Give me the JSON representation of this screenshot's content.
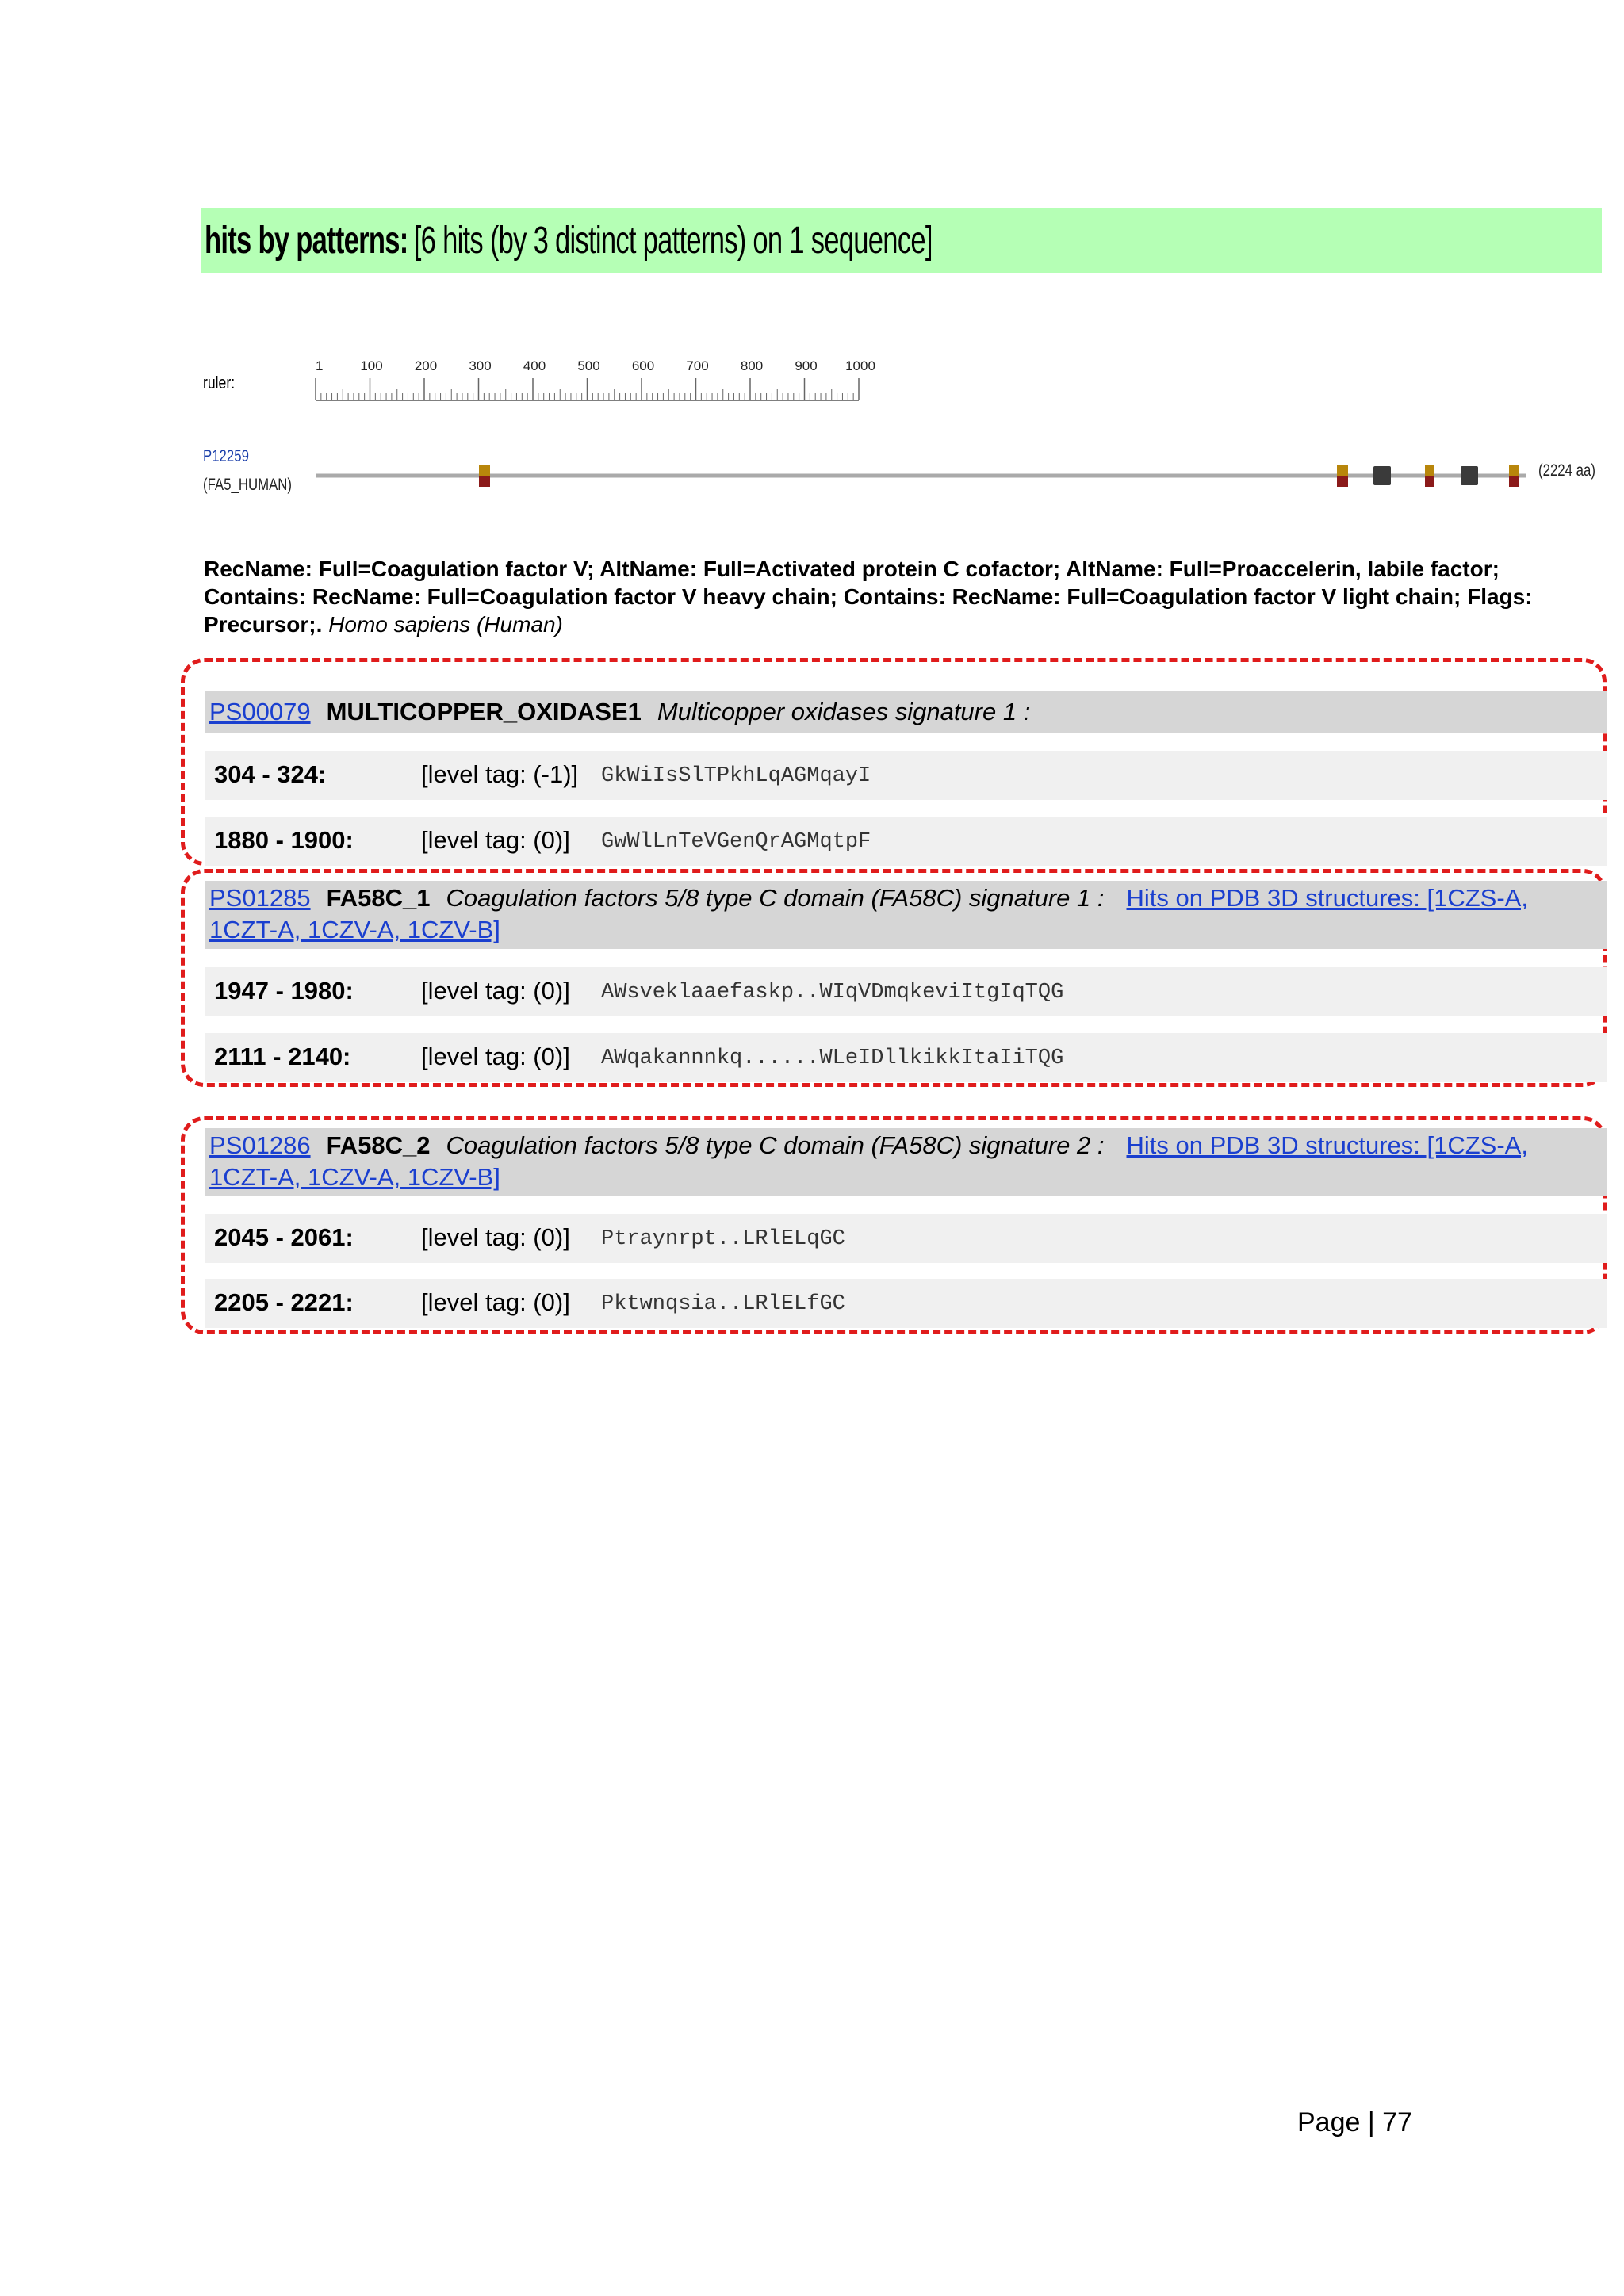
{
  "banner": {
    "title": "hits by patterns:",
    "subtitle": "[6 hits (by 3 distinct patterns) on 1 sequence]"
  },
  "ruler": {
    "label": "ruler:",
    "ticks": [
      "1",
      "100",
      "200",
      "300",
      "400",
      "500",
      "600",
      "700",
      "800",
      "900",
      "1000"
    ]
  },
  "sequence": {
    "accession": "P12259",
    "id": "(FA5_HUMAN)",
    "length_label": "(2224 aa)",
    "description": "RecName: Full=Coagulation factor V; AltName: Full=Activated protein C cofactor; AltName: Full=Proaccelerin, labile factor; Contains: RecName: Full=Coagulation factor V heavy chain; Contains: RecName: Full=Coagulation factor V light chain; Flags: Precursor;.",
    "species": "Homo sapiens (Human)",
    "hit_colors": [
      "#b8860b",
      "#8b1a1a",
      "#3a3a3a"
    ]
  },
  "patterns": [
    {
      "accession": "PS00079",
      "name": "MULTICOPPER_OXIDASE1",
      "description": "Multicopper oxidases signature 1 :",
      "pdb": "",
      "hits": [
        {
          "range": "304 - 324:",
          "level": "[level tag: (-1)]",
          "sequence": "GkWiIsSlTPkhLqAGMqayI"
        },
        {
          "range": "1880 - 1900:",
          "level": "[level tag: (0)]",
          "sequence": "GwWlLnTeVGenQrAGMqtpF"
        }
      ]
    },
    {
      "accession": "PS01285",
      "name": "FA58C_1",
      "description": "Coagulation factors 5/8 type C domain (FA58C) signature 1 :",
      "pdb": "Hits on PDB 3D structures: [1CZS-A, 1CZT-A, 1CZV-A, 1CZV-B]",
      "hits": [
        {
          "range": "1947 - 1980:",
          "level": "[level tag: (0)]",
          "sequence": "AWsveklaaefaskp..WIqVDmqkeviItgIqTQG"
        },
        {
          "range": "2111 - 2140:",
          "level": "[level tag: (0)]",
          "sequence": "AWqakannnkq......WLeIDllkikkItaIiTQG"
        }
      ]
    },
    {
      "accession": "PS01286",
      "name": "FA58C_2",
      "description": "Coagulation factors 5/8 type C domain (FA58C) signature 2 :",
      "pdb": "Hits on PDB 3D structures: [1CZS-A, 1CZT-A, 1CZV-A, 1CZV-B]",
      "hits": [
        {
          "range": "2045 - 2061:",
          "level": "[level tag: (0)]",
          "sequence": "Ptraynrpt..LRlELqGC"
        },
        {
          "range": "2205 - 2221:",
          "level": "[level tag: (0)]",
          "sequence": "Pktwnqsia..LRlELfGC"
        }
      ]
    }
  ],
  "footer": {
    "page_label": "Page | 77"
  }
}
